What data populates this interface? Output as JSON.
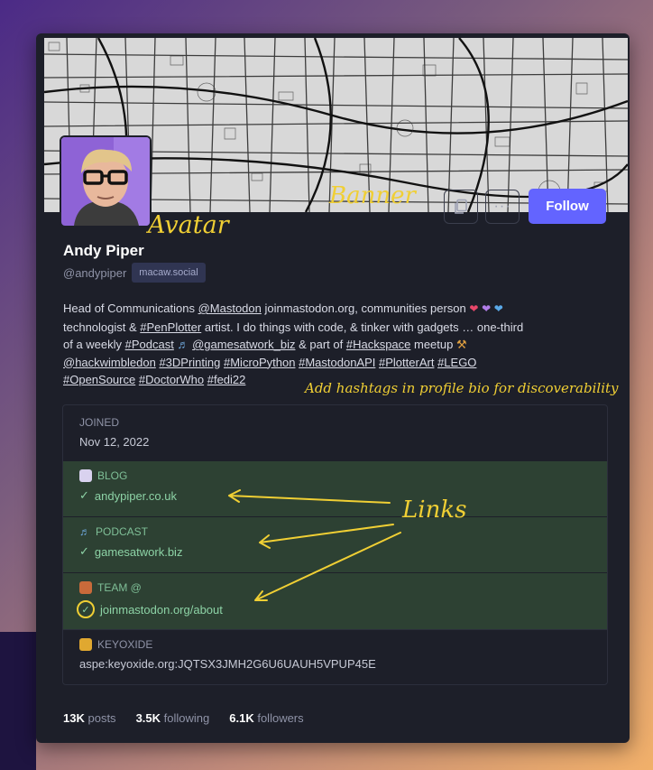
{
  "profile": {
    "display_name": "Andy Piper",
    "handle": "@andypiper",
    "server": "macaw.social",
    "bio": {
      "line1_a": "Head of Communications ",
      "mention_mastodon": "@Mastodon",
      "line1_b": " joinmastodon.org, communities person ",
      "line2_a": "technologist & ",
      "tag_penplotter": "#PenPlotter",
      "line2_b": " artist. I do things with code, & tinker with gadgets … one-third",
      "line3_a": "of a weekly ",
      "tag_podcast": "#Podcast",
      "mention_gamesatwork": "@gamesatwork_biz",
      "line3_b": " & part of ",
      "tag_hackspace": "#Hackspace",
      "line3_c": " meetup ",
      "mention_hackwimbledon": "@hackwimbledon",
      "tag_3dprinting": "#3DPrinting",
      "tag_micropython": "#MicroPython",
      "tag_mastodonapi": "#MastodonAPI",
      "tag_plotterart": "#PlotterArt",
      "tag_lego": "#LEGO",
      "tag_opensource": "#OpenSource",
      "tag_doctorwho": "#DoctorWho",
      "tag_fedi22": "#fedi22"
    },
    "fields": {
      "joined_label": "JOINED",
      "joined_value": "Nov 12, 2022",
      "blog_label": "BLOG",
      "blog_value": "andypiper.co.uk",
      "podcast_label": "PODCAST",
      "podcast_value": "gamesatwork.biz",
      "team_label": "TEAM @",
      "team_value": "joinmastodon.org/about",
      "keyoxide_label": "KEYOXIDE",
      "keyoxide_value": "aspe:keyoxide.org:JQTSX3JMH2G6U6UAUH5VPUP45E"
    },
    "stats": {
      "posts_count": "13K",
      "posts_label": "posts",
      "following_count": "3.5K",
      "following_label": "following",
      "followers_count": "6.1K",
      "followers_label": "followers"
    }
  },
  "buttons": {
    "follow_label": "Follow"
  },
  "icons": {
    "copy": "copy-icon",
    "more": "more-icon"
  },
  "annotations": {
    "banner": "Banner",
    "avatar": "Avatar",
    "links": "Links",
    "hashtags": "Add hashtags in profile bio for discoverability"
  },
  "colors": {
    "accent": "#6364ff",
    "card_bg": "#1d1f29",
    "verified_bg": "#2d4133",
    "verified_text": "#8dd3a6",
    "annotation": "#f0cf34"
  }
}
